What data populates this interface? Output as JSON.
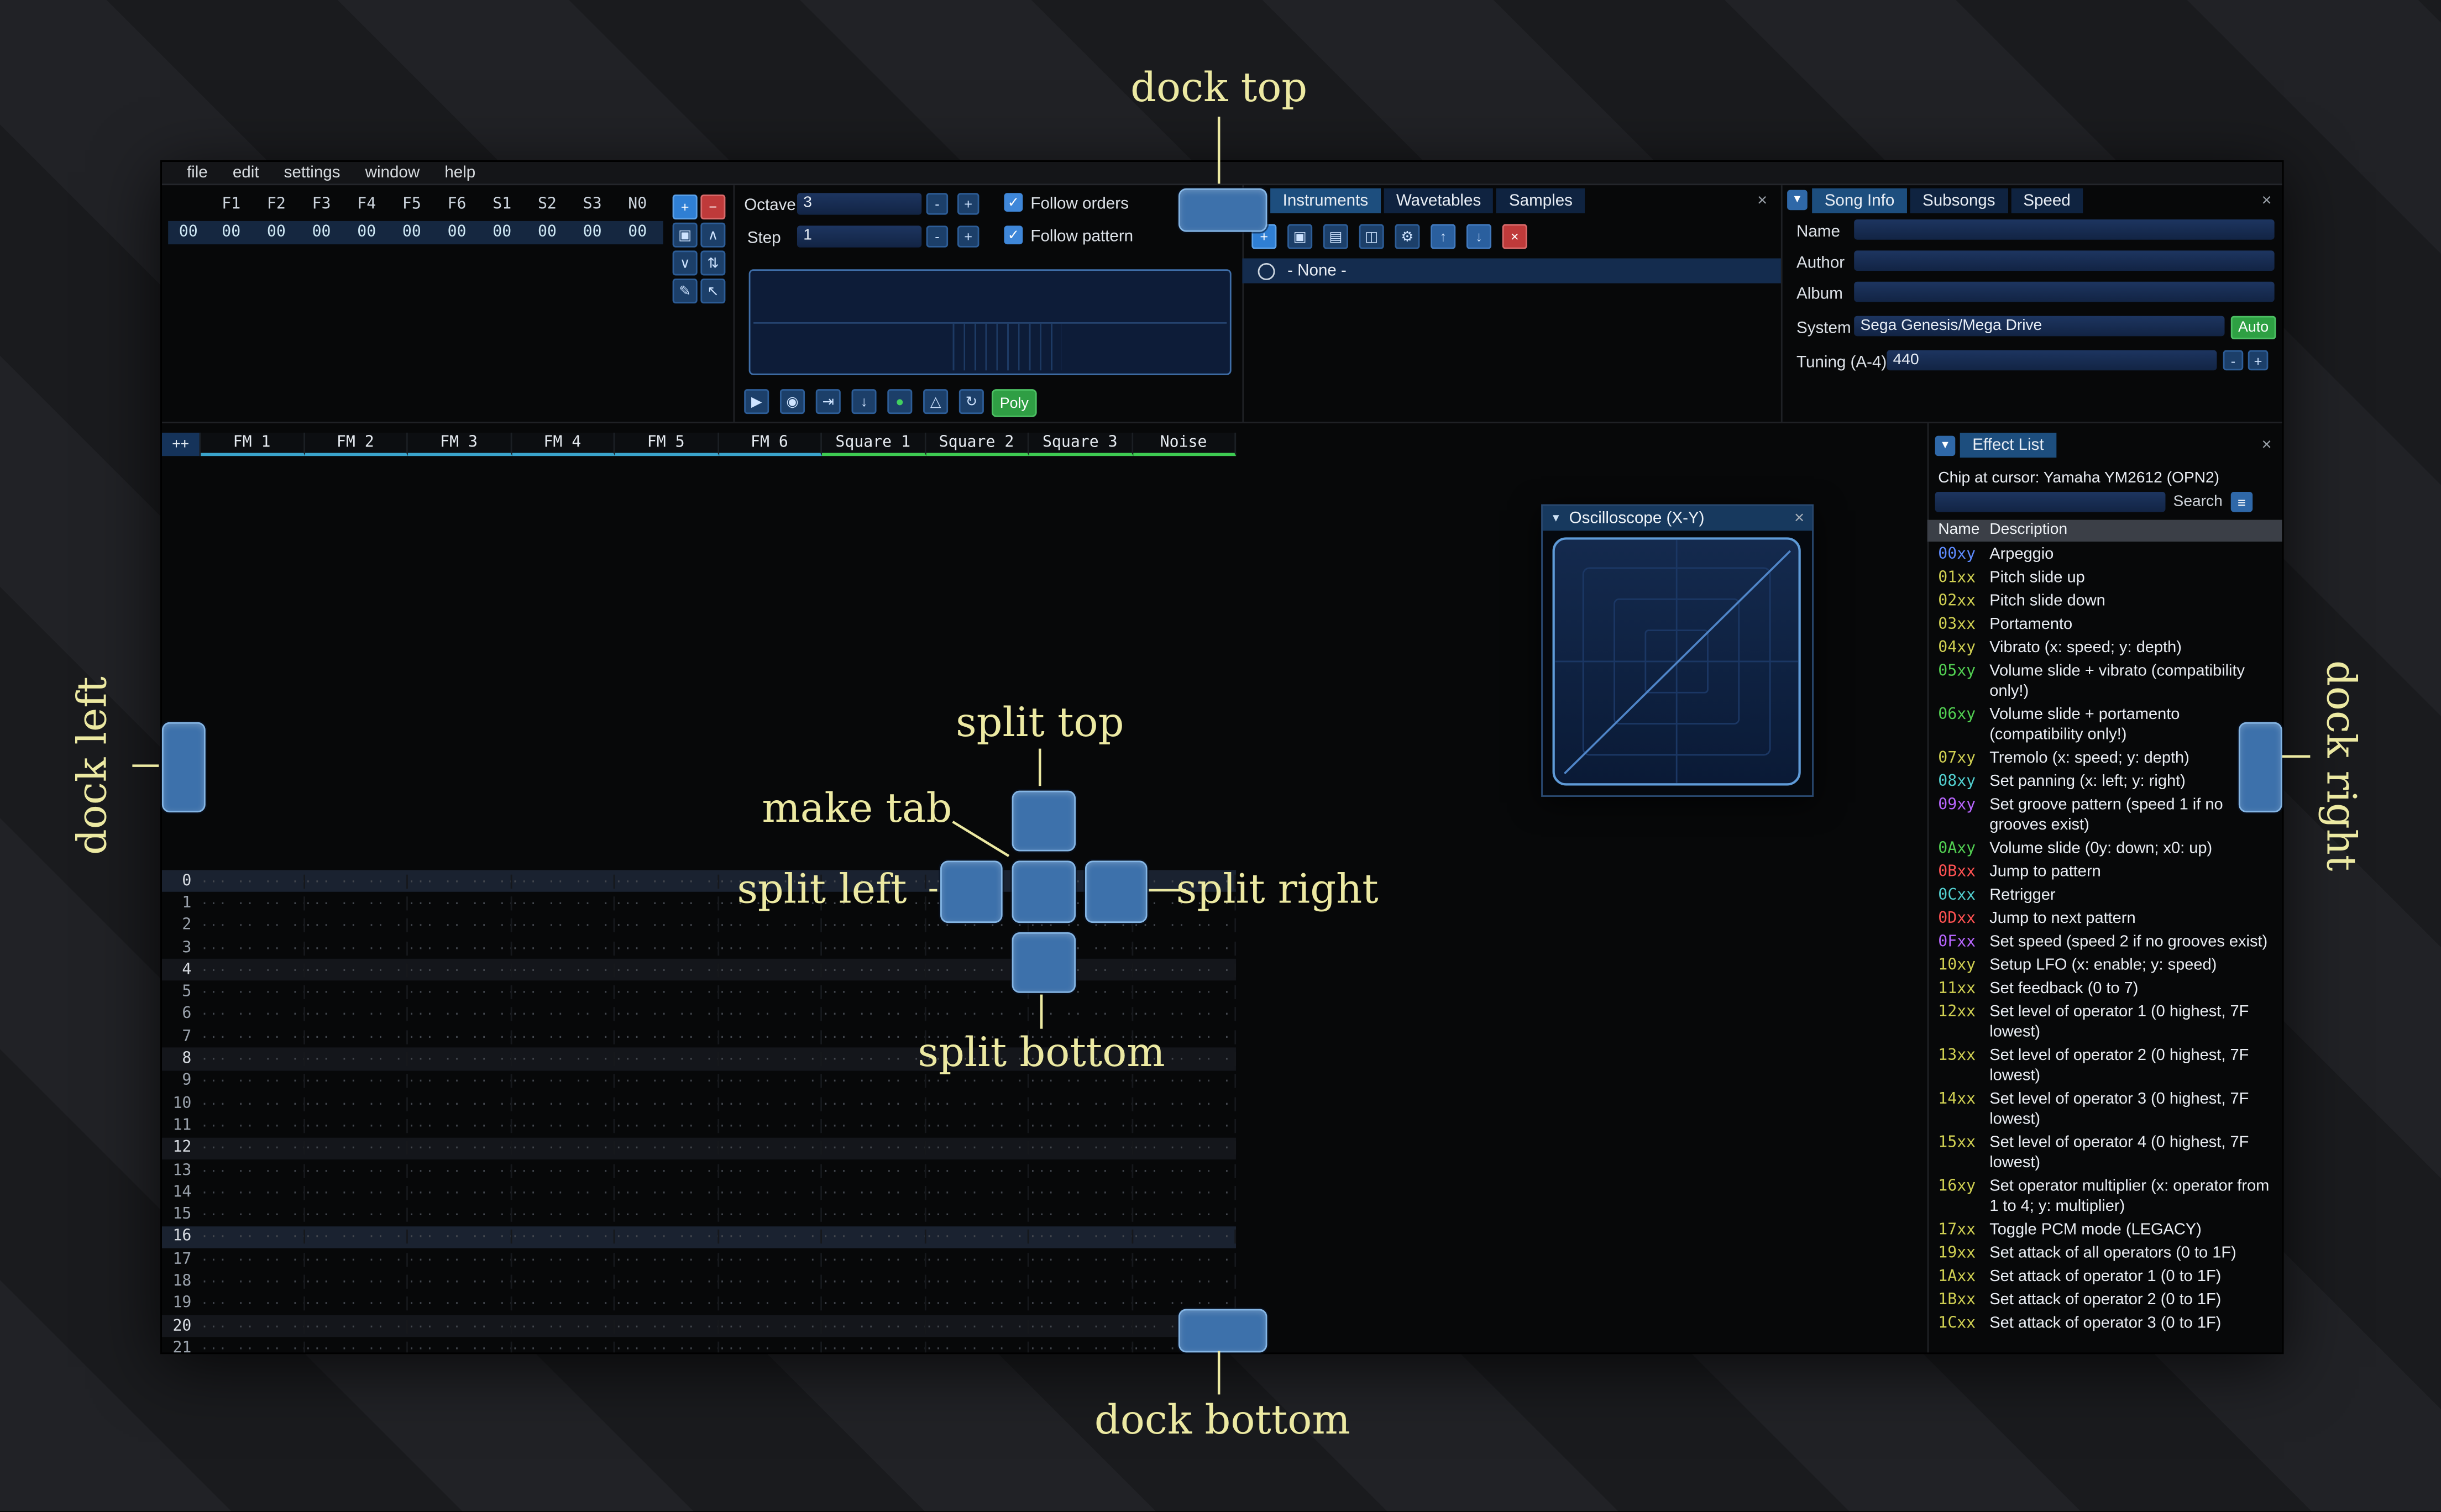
{
  "ui": {
    "close": "×",
    "collapse": "▼",
    "minus": "-",
    "plus": "+",
    "check": "✓",
    "hamburger": "≡"
  },
  "annotations": {
    "dock_top": "dock top",
    "dock_left": "dock left",
    "dock_right": "dock right",
    "dock_bottom": "dock bottom",
    "split_top": "split top",
    "split_left": "split left",
    "split_right": "split right",
    "split_bottom": "split bottom",
    "make_tab": "make tab"
  },
  "window": {
    "menu": [
      "file",
      "edit",
      "settings",
      "window",
      "help"
    ]
  },
  "orders": {
    "index_value": "00",
    "columns": [
      "F1",
      "F2",
      "F3",
      "F4",
      "F5",
      "F6",
      "S1",
      "S2",
      "S3",
      "N0"
    ],
    "values": [
      "00",
      "00",
      "00",
      "00",
      "00",
      "00",
      "00",
      "00",
      "00",
      "00"
    ],
    "buttons": [
      {
        "name": "add-order",
        "icon": "+",
        "style": "btn-add"
      },
      {
        "name": "remove-order",
        "icon": "−",
        "style": "btn-del"
      },
      {
        "name": "duplicate-order",
        "icon": "▣",
        "style": ""
      },
      {
        "name": "move-order-up",
        "icon": "∧",
        "style": ""
      },
      {
        "name": "move-order-down",
        "icon": "∨",
        "style": ""
      },
      {
        "name": "order-swap",
        "icon": "⇅",
        "style": ""
      },
      {
        "name": "order-edit-mode",
        "icon": "✎",
        "style": ""
      },
      {
        "name": "order-cursor-mode",
        "icon": "↖",
        "style": ""
      }
    ]
  },
  "transport": {
    "octave_label": "Octave",
    "octave_value": "3",
    "step_label": "Step",
    "step_value": "1",
    "follow_orders": "Follow orders",
    "follow_pattern": "Follow pattern",
    "poly": "Poly",
    "buttons": [
      {
        "name": "play-button",
        "icon": "▶"
      },
      {
        "name": "play-pattern-button",
        "icon": "◉"
      },
      {
        "name": "play-from-cursor-button",
        "icon": "⇥"
      },
      {
        "name": "step-row-button",
        "icon": "↓"
      },
      {
        "name": "edit-toggle-button",
        "icon": "●",
        "color": "#41d05f"
      },
      {
        "name": "metronome-button",
        "icon": "△"
      },
      {
        "name": "repeat-pattern-button",
        "icon": "↻"
      }
    ]
  },
  "instruments": {
    "tabs": [
      "Instruments",
      "Wavetables",
      "Samples"
    ],
    "active_tab": 0,
    "none_label": "- None -",
    "toolbar": [
      {
        "name": "add-instrument",
        "icon": "+",
        "style": "btn-add"
      },
      {
        "name": "duplicate-instrument",
        "icon": "▣",
        "style": ""
      },
      {
        "name": "open-instrument",
        "icon": "▤",
        "style": ""
      },
      {
        "name": "save-instrument",
        "icon": "◫",
        "style": ""
      },
      {
        "name": "instrument-organize",
        "icon": "⚙",
        "style": ""
      },
      {
        "name": "move-instrument-up",
        "icon": "↑",
        "style": "btn-arrow"
      },
      {
        "name": "move-instrument-down",
        "icon": "↓",
        "style": "btn-arrow"
      },
      {
        "name": "delete-instrument",
        "icon": "×",
        "style": "btn-del"
      }
    ]
  },
  "song_info": {
    "tabs": [
      "Song Info",
      "Subsongs",
      "Speed"
    ],
    "active_tab": 0,
    "name_label": "Name",
    "name_value": "",
    "author_label": "Author",
    "author_value": "",
    "album_label": "Album",
    "album_value": "",
    "system_label": "System",
    "system_value": "Sega Genesis/Mega Drive",
    "auto_label": "Auto",
    "tuning_label": "Tuning (A-4)",
    "tuning_value": "440"
  },
  "pattern": {
    "corner_label": "++",
    "row_count": 22,
    "empty_cell": "··· ·· ·· ···",
    "channels": [
      {
        "name": "FM 1",
        "color": "#3aa4cc"
      },
      {
        "name": "FM 2",
        "color": "#3aa4cc"
      },
      {
        "name": "FM 3",
        "color": "#3aa4cc"
      },
      {
        "name": "FM 4",
        "color": "#3aa4cc"
      },
      {
        "name": "FM 5",
        "color": "#3aa4cc"
      },
      {
        "name": "FM 6",
        "color": "#3aa4cc"
      },
      {
        "name": "Square 1",
        "color": "#3ecb52"
      },
      {
        "name": "Square 2",
        "color": "#3ecb52"
      },
      {
        "name": "Square 3",
        "color": "#3ecb52"
      },
      {
        "name": "Noise",
        "color": "#3ecb52"
      }
    ]
  },
  "oscilloscope": {
    "title": "Oscilloscope (X-Y)"
  },
  "effect_list": {
    "title": "Effect List",
    "chip_line": "Chip at cursor: Yamaha YM2612 (OPN2)",
    "search_label": "Search",
    "name_header": "Name",
    "desc_header": "Description",
    "effects": [
      {
        "code": "00xy",
        "desc": "Arpeggio",
        "color": "#5e8bff"
      },
      {
        "code": "01xx",
        "desc": "Pitch slide up",
        "color": "#d0d052"
      },
      {
        "code": "02xx",
        "desc": "Pitch slide down",
        "color": "#d0d052"
      },
      {
        "code": "03xx",
        "desc": "Portamento",
        "color": "#d0d052"
      },
      {
        "code": "04xy",
        "desc": "Vibrato (x: speed; y: depth)",
        "color": "#d0d052"
      },
      {
        "code": "05xy",
        "desc": "Volume slide + vibrato (compatibility only!)",
        "color": "#52d052"
      },
      {
        "code": "06xy",
        "desc": "Volume slide + portamento (compatibility only!)",
        "color": "#52d052"
      },
      {
        "code": "07xy",
        "desc": "Tremolo (x: speed; y: depth)",
        "color": "#d0d052"
      },
      {
        "code": "08xy",
        "desc": "Set panning (x: left; y: right)",
        "color": "#52d0d0"
      },
      {
        "code": "09xy",
        "desc": "Set groove pattern (speed 1 if no grooves exist)",
        "color": "#b866ff"
      },
      {
        "code": "0Axy",
        "desc": "Volume slide (0y: down; x0: up)",
        "color": "#52d052"
      },
      {
        "code": "0Bxx",
        "desc": "Jump to pattern",
        "color": "#ff5252"
      },
      {
        "code": "0Cxx",
        "desc": "Retrigger",
        "color": "#52d0d0"
      },
      {
        "code": "0Dxx",
        "desc": "Jump to next pattern",
        "color": "#ff5252"
      },
      {
        "code": "0Fxx",
        "desc": "Set speed (speed 2 if no grooves exist)",
        "color": "#b866ff"
      },
      {
        "code": "10xy",
        "desc": "Setup LFO (x: enable; y: speed)",
        "color": "#d0d052"
      },
      {
        "code": "11xx",
        "desc": "Set feedback (0 to 7)",
        "color": "#d0d052"
      },
      {
        "code": "12xx",
        "desc": "Set level of operator 1 (0 highest, 7F lowest)",
        "color": "#d0d052"
      },
      {
        "code": "13xx",
        "desc": "Set level of operator 2 (0 highest, 7F lowest)",
        "color": "#d0d052"
      },
      {
        "code": "14xx",
        "desc": "Set level of operator 3 (0 highest, 7F lowest)",
        "color": "#d0d052"
      },
      {
        "code": "15xx",
        "desc": "Set level of operator 4 (0 highest, 7F lowest)",
        "color": "#d0d052"
      },
      {
        "code": "16xy",
        "desc": "Set operator multiplier (x: operator from 1 to 4; y: multiplier)",
        "color": "#d0d052"
      },
      {
        "code": "17xx",
        "desc": "Toggle PCM mode (LEGACY)",
        "color": "#d0d052"
      },
      {
        "code": "19xx",
        "desc": "Set attack of all operators (0 to 1F)",
        "color": "#d0d052"
      },
      {
        "code": "1Axx",
        "desc": "Set attack of operator 1 (0 to 1F)",
        "color": "#d0d052"
      },
      {
        "code": "1Bxx",
        "desc": "Set attack of operator 2 (0 to 1F)",
        "color": "#d0d052"
      },
      {
        "code": "1Cxx",
        "desc": "Set attack of operator 3 (0 to 1F)",
        "color": "#d0d052"
      }
    ]
  }
}
